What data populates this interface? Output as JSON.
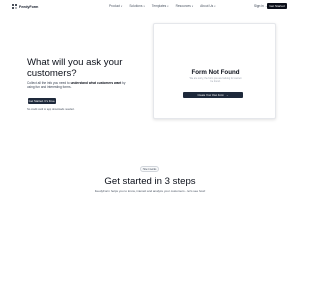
{
  "nav": {
    "logo_text": "FeedyForm",
    "menu": [
      {
        "label": "Product"
      },
      {
        "label": "Solutions"
      },
      {
        "label": "Templates"
      },
      {
        "label": "Resources"
      },
      {
        "label": "About Us"
      }
    ],
    "sign_in": "Sign in",
    "get_started": "Get Started"
  },
  "hero": {
    "title": "What will you ask your customers?",
    "desc_prefix": "Collect all the info you need to ",
    "desc_bold": "understand what customers want",
    "desc_suffix": " by using fun and interesting forms.",
    "cta": "Get Started. It's Free.",
    "note": "No credit card or app downloads needed."
  },
  "card": {
    "title": "Form Not Found",
    "message": "We are sorry, the form you are looking for cannot be found.",
    "button": "Create Your Own Form"
  },
  "steps": {
    "badge": "How it works",
    "title": "Get started in 3 steps",
    "subtitle": "FeedyForm helps you to know, interact and analyze your customers - let's see how!"
  },
  "colors": {
    "dark": "#0b0f19",
    "button": "#1e293b",
    "muted": "#6b7280"
  }
}
